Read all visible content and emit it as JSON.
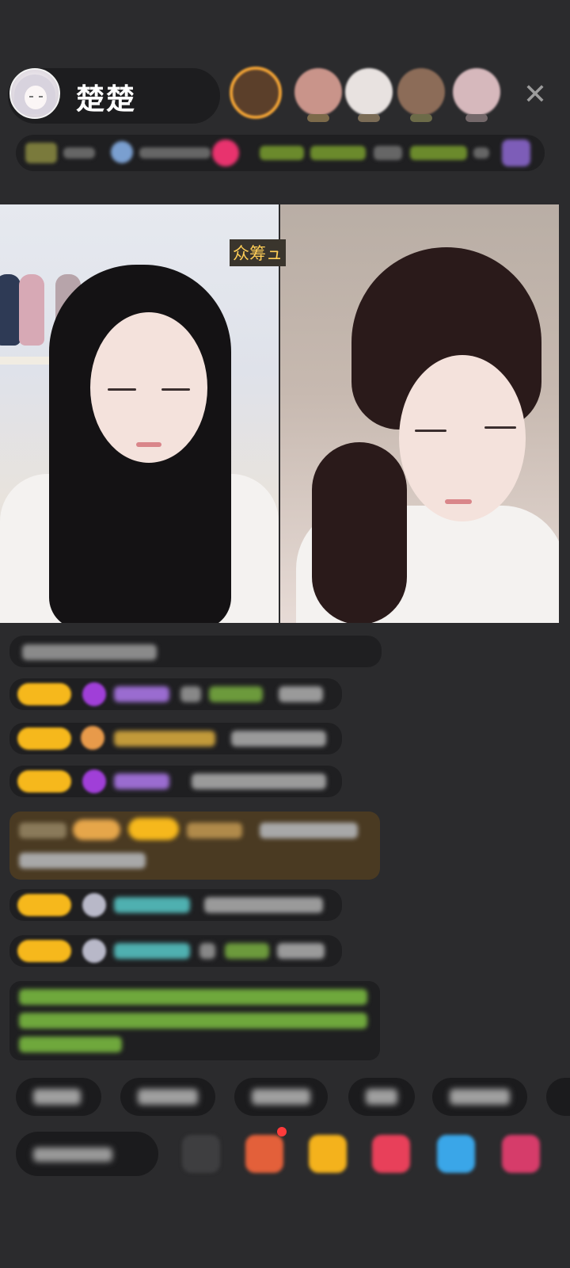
{
  "header": {
    "host_name": "楚楚",
    "close_icon": "close-icon",
    "viewer_avatar_count": 5
  },
  "video": {
    "crowdfunding_tag": "众筹ュ"
  },
  "colors": {
    "background": "#2b2b2d",
    "badge_gold": "#f6b81c",
    "green_text": "#8fd14f",
    "cyan_text": "#4fd1d1"
  }
}
